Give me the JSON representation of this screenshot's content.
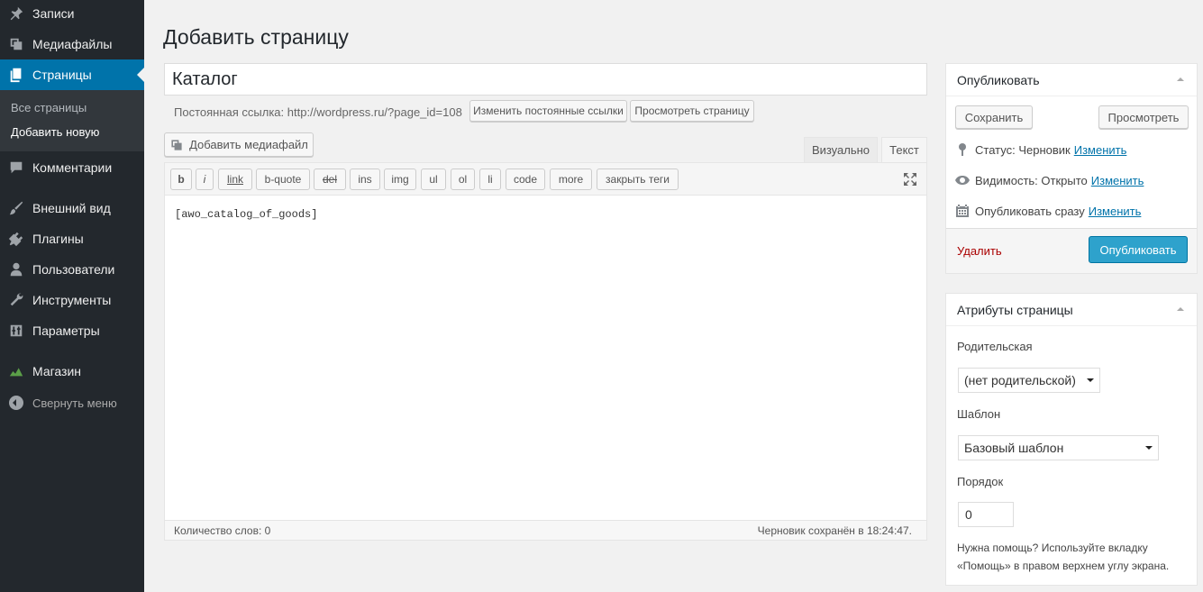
{
  "sidebar": {
    "items": [
      {
        "label": "Записи",
        "icon": "pin-icon"
      },
      {
        "label": "Медиафайлы",
        "icon": "media-icon"
      },
      {
        "label": "Страницы",
        "icon": "pages-icon",
        "current": true
      },
      {
        "label": "Комментарии",
        "icon": "comments-icon"
      },
      {
        "label": "Внешний вид",
        "icon": "brush-icon"
      },
      {
        "label": "Плагины",
        "icon": "plugin-icon"
      },
      {
        "label": "Пользователи",
        "icon": "user-icon"
      },
      {
        "label": "Инструменты",
        "icon": "wrench-icon"
      },
      {
        "label": "Параметры",
        "icon": "settings-icon"
      },
      {
        "label": "Магазин",
        "icon": "shop-icon"
      }
    ],
    "submenu": [
      "Все страницы",
      "Добавить новую"
    ],
    "collapse": "Свернуть меню"
  },
  "page": {
    "title": "Добавить страницу",
    "post_title": "Каталог",
    "permalink_label": "Постоянная ссылка:",
    "permalink_url": "http://wordpress.ru/?page_id=108",
    "change_permalinks": "Изменить постоянные ссылки",
    "view_page": "Просмотреть страницу"
  },
  "editor": {
    "add_media": "Добавить медиафайл",
    "tab_visual": "Визуально",
    "tab_text": "Текст",
    "quicktags": [
      "b",
      "i",
      "link",
      "b-quote",
      "del",
      "ins",
      "img",
      "ul",
      "ol",
      "li",
      "code",
      "more",
      "закрыть теги"
    ],
    "content": "[awo_catalog_of_goods]",
    "word_count": "Количество слов: 0",
    "draft_saved": "Черновик сохранён в 18:24:47."
  },
  "publish": {
    "title": "Опубликовать",
    "save": "Сохранить",
    "preview": "Просмотреть",
    "status_label": "Статус: Черновик",
    "visibility_label": "Видимость: Открыто",
    "schedule_label": "Опубликовать сразу",
    "edit": "Изменить",
    "delete": "Удалить",
    "publish": "Опубликовать"
  },
  "attributes": {
    "title": "Атрибуты страницы",
    "parent_label": "Родительская",
    "parent_value": "(нет родительской)",
    "template_label": "Шаблон",
    "template_value": "Базовый шаблон",
    "order_label": "Порядок",
    "order_value": "0",
    "help": "Нужна помощь? Используйте вкладку «Помощь» в правом верхнем углу экрана."
  },
  "colors": {
    "sidebar_bg": "#23282d",
    "accent": "#0073aa",
    "publish_button": "#2ea2cc"
  }
}
